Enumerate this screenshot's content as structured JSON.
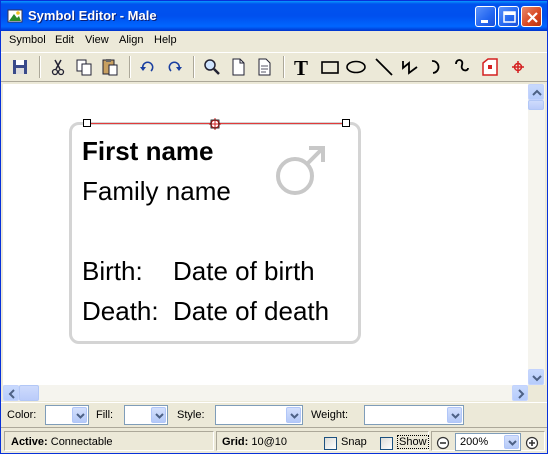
{
  "window": {
    "title": "Symbol Editor - Male",
    "icon": "app-icon",
    "controls": [
      "minimize-icon",
      "maximize-icon",
      "close-icon"
    ]
  },
  "menu": {
    "symbol": "Symbol",
    "edit": "Edit",
    "view": "View",
    "align": "Align",
    "help": "Help"
  },
  "toolbar": {
    "buttons": [
      "save-icon",
      "cut-icon",
      "copy-icon",
      "paste-icon",
      "undo-icon",
      "redo-icon",
      "zoom-icon",
      "page-icon",
      "page-properties-icon",
      "text-tool-icon",
      "rectangle-tool-icon",
      "ellipse-tool-icon",
      "line-tool-icon",
      "polyline-tool-icon",
      "arc-tool-icon",
      "curve-tool-icon",
      "connectable-shape-icon",
      "anchor-point-icon"
    ],
    "text_tool_glyph": "T"
  },
  "symbol": {
    "first_name": "First name",
    "family_name": "Family name",
    "birth_label": "Birth:",
    "birth_value": "Date of birth",
    "death_label": "Death:",
    "death_value": "Date of death",
    "gender_icon": "male-symbol-icon",
    "gender_color": "#c8c8c8",
    "selection_color": "#e23b3b"
  },
  "properties": {
    "color_label": "Color:",
    "fill_label": "Fill:",
    "style_label": "Style:",
    "weight_label": "Weight:",
    "color_value": "",
    "fill_value": "",
    "style_value": "",
    "weight_value": ""
  },
  "status": {
    "active_label": "Active:",
    "active_value": "Connectable",
    "grid_label": "Grid:",
    "grid_value": "10@10",
    "snap_label": "Snap",
    "snap_checked": false,
    "show_label": "Show",
    "show_checked": false,
    "zoom_value": "200%"
  },
  "colors": {
    "titlebar": "#0054e3",
    "chrome": "#ece9d8",
    "canvas": "#ffffff",
    "card_border": "#d4d4d4"
  }
}
